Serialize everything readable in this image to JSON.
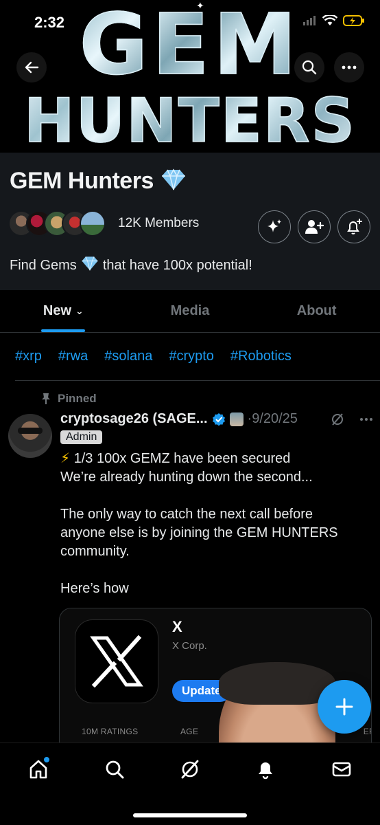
{
  "status_bar": {
    "time": "2:32"
  },
  "banner": {
    "line1": "GEM",
    "line2": "HUNTERS"
  },
  "community": {
    "name": "GEM Hunters",
    "members": "12K Members",
    "description_before": "Find Gems",
    "description_after": "that have 100x potential!"
  },
  "tabs": [
    {
      "label": "New",
      "active": true
    },
    {
      "label": "Media",
      "active": false
    },
    {
      "label": "About",
      "active": false
    }
  ],
  "hashtags": [
    "#xrp",
    "#rwa",
    "#solana",
    "#crypto",
    "#Robotics"
  ],
  "post": {
    "pinned_label": "Pinned",
    "author": "cryptosage26 (SAGE...",
    "date": "·9/20/25",
    "role_badge": "Admin",
    "line1": "1/3 100x GEMZ have been secured",
    "line2": "We’re already hunting down the second...",
    "line3": "The only way to catch the next call before",
    "line4": "anyone else is by joining the GEM HUNTERS",
    "line5": "community.",
    "line6": "Here’s how"
  },
  "app_card": {
    "name": "X",
    "developer": "X Corp.",
    "update_label": "Update",
    "ratings_label": "10M RATINGS",
    "age_label": "AGE",
    "third_label": "ER"
  },
  "colors": {
    "accent": "#1d9bf0",
    "background": "#000000",
    "header_bg": "#15181c"
  }
}
